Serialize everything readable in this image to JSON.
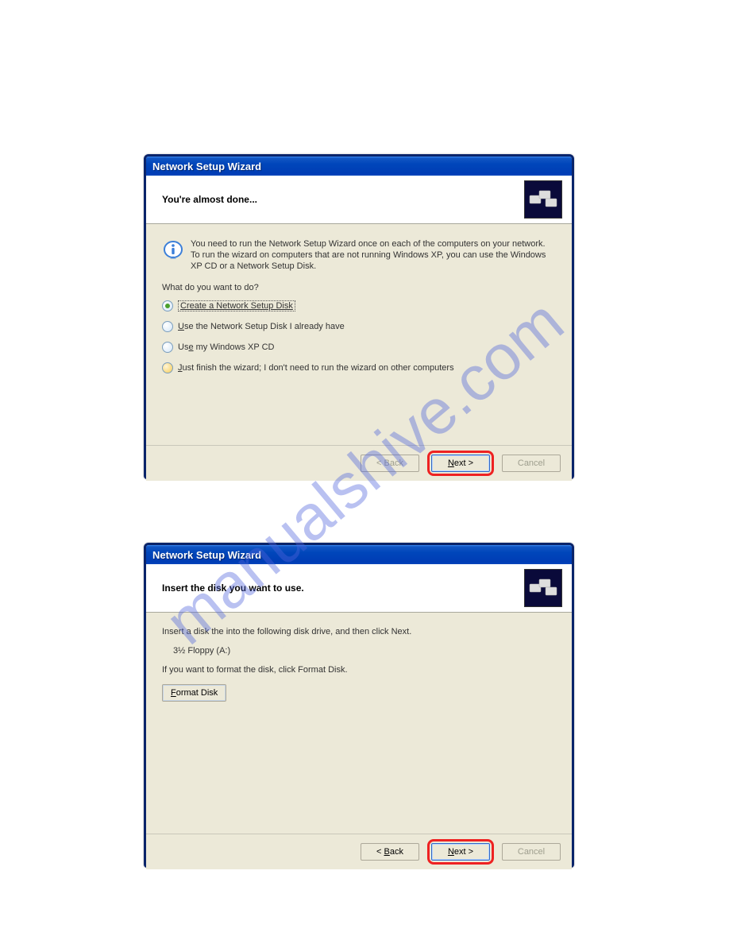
{
  "watermark": "manualshive.com",
  "dialog1": {
    "title": "Network Setup Wizard",
    "heading": "You're almost done...",
    "info": "You need to run the Network Setup Wizard once on each of the computers on your network. To run the wizard on computers that are not running Windows XP, you can use the Windows XP CD or a Network Setup Disk.",
    "prompt": "What do you want to do?",
    "options": {
      "o1": "Create a Network Setup Disk",
      "o2_pre": "U",
      "o2_rest": "se the Network Setup Disk I already have",
      "o3_pre": "Us",
      "o3_u": "e",
      "o3_rest": " my Windows XP CD",
      "o4_pre": "J",
      "o4_rest": "ust finish the wizard; I don't need to run the wizard on other computers"
    },
    "back": "< Back",
    "next_pre": "N",
    "next_rest": "ext >",
    "cancel": "Cancel"
  },
  "dialog2": {
    "title": "Network Setup Wizard",
    "heading": "Insert the disk you want to use.",
    "line1": "Insert a disk the into the following disk drive, and then click Next.",
    "drive": "3½ Floppy (A:)",
    "line2": "If you want to format the disk, click Format Disk.",
    "format_pre": "F",
    "format_rest": "ormat Disk",
    "back_pre": "< ",
    "back_u": "B",
    "back_rest": "ack",
    "next_pre": "N",
    "next_rest": "ext >",
    "cancel": "Cancel"
  }
}
